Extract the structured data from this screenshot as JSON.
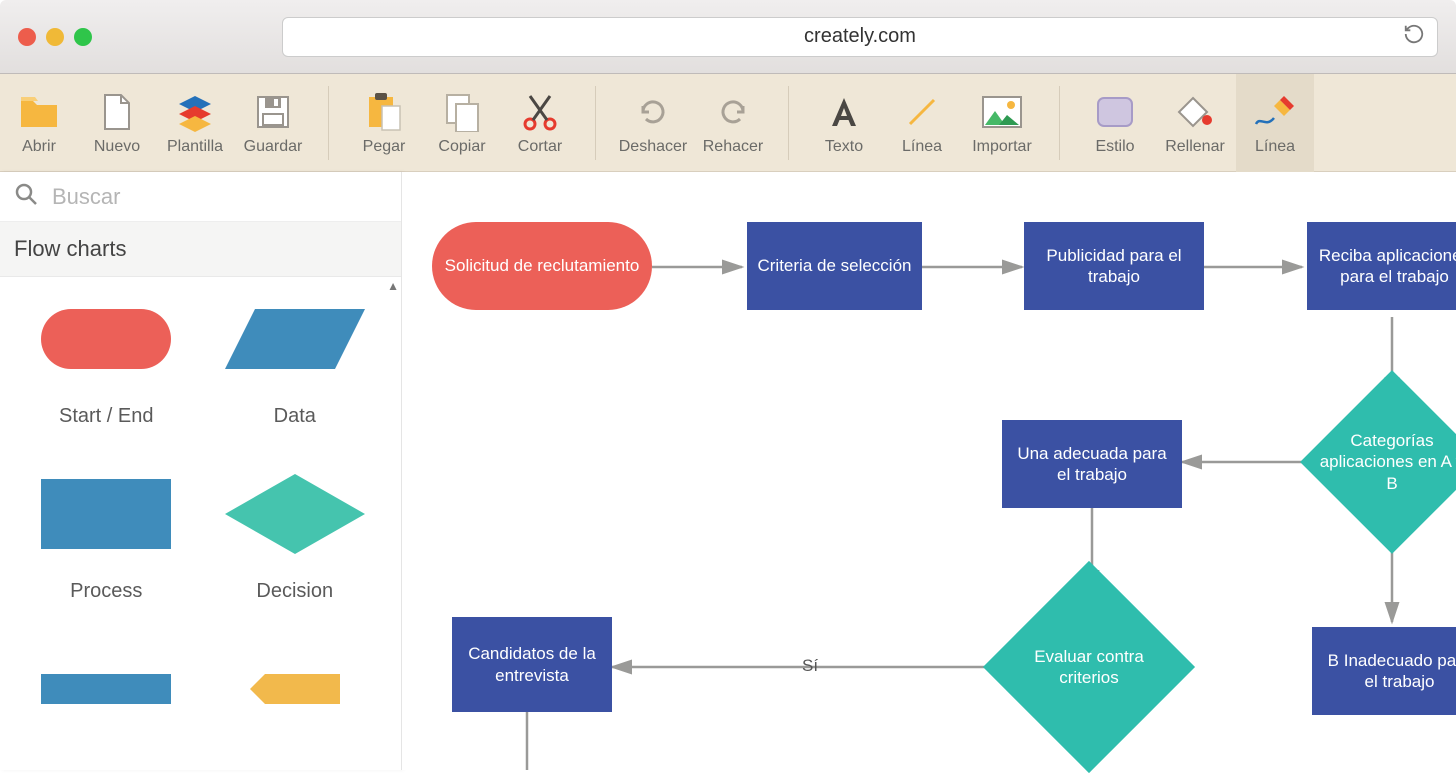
{
  "browser": {
    "url": "creately.com"
  },
  "toolbar": {
    "items": [
      {
        "label": "Abrir"
      },
      {
        "label": "Nuevo"
      },
      {
        "label": "Plantilla"
      },
      {
        "label": "Guardar"
      },
      {
        "label": "Pegar"
      },
      {
        "label": "Copiar"
      },
      {
        "label": "Cortar"
      },
      {
        "label": "Deshacer"
      },
      {
        "label": "Rehacer"
      },
      {
        "label": "Texto"
      },
      {
        "label": "Línea"
      },
      {
        "label": "Importar"
      },
      {
        "label": "Estilo"
      },
      {
        "label": "Rellenar"
      },
      {
        "label": "Línea"
      }
    ]
  },
  "sidebar": {
    "search_placeholder": "Buscar",
    "category": "Flow charts",
    "shapes": [
      {
        "label": "Start / End"
      },
      {
        "label": "Data"
      },
      {
        "label": "Process"
      },
      {
        "label": "Decision"
      }
    ]
  },
  "flowchart": {
    "nodes": {
      "start": "Solicitud de reclutamiento",
      "criteria": "Criteria de selección",
      "publicidad": "Publicidad para el trabajo",
      "reciba": "Reciba aplicaciones para el trabajo",
      "categorias": "Categorías aplicaciones en A y B",
      "adecuada": "Una adecuada para el trabajo",
      "inadecuado": "B Inadecuado para el trabajo",
      "evaluar": "Evaluar contra criterios",
      "candidatos": "Candidatos de la entrevista"
    },
    "edges": {
      "si": "Sí"
    }
  },
  "colors": {
    "process": "#3b51a3",
    "start": "#ec6058",
    "decision": "#2fbdad",
    "folder": "#f6b740",
    "accent_blue": "#2471ba"
  }
}
